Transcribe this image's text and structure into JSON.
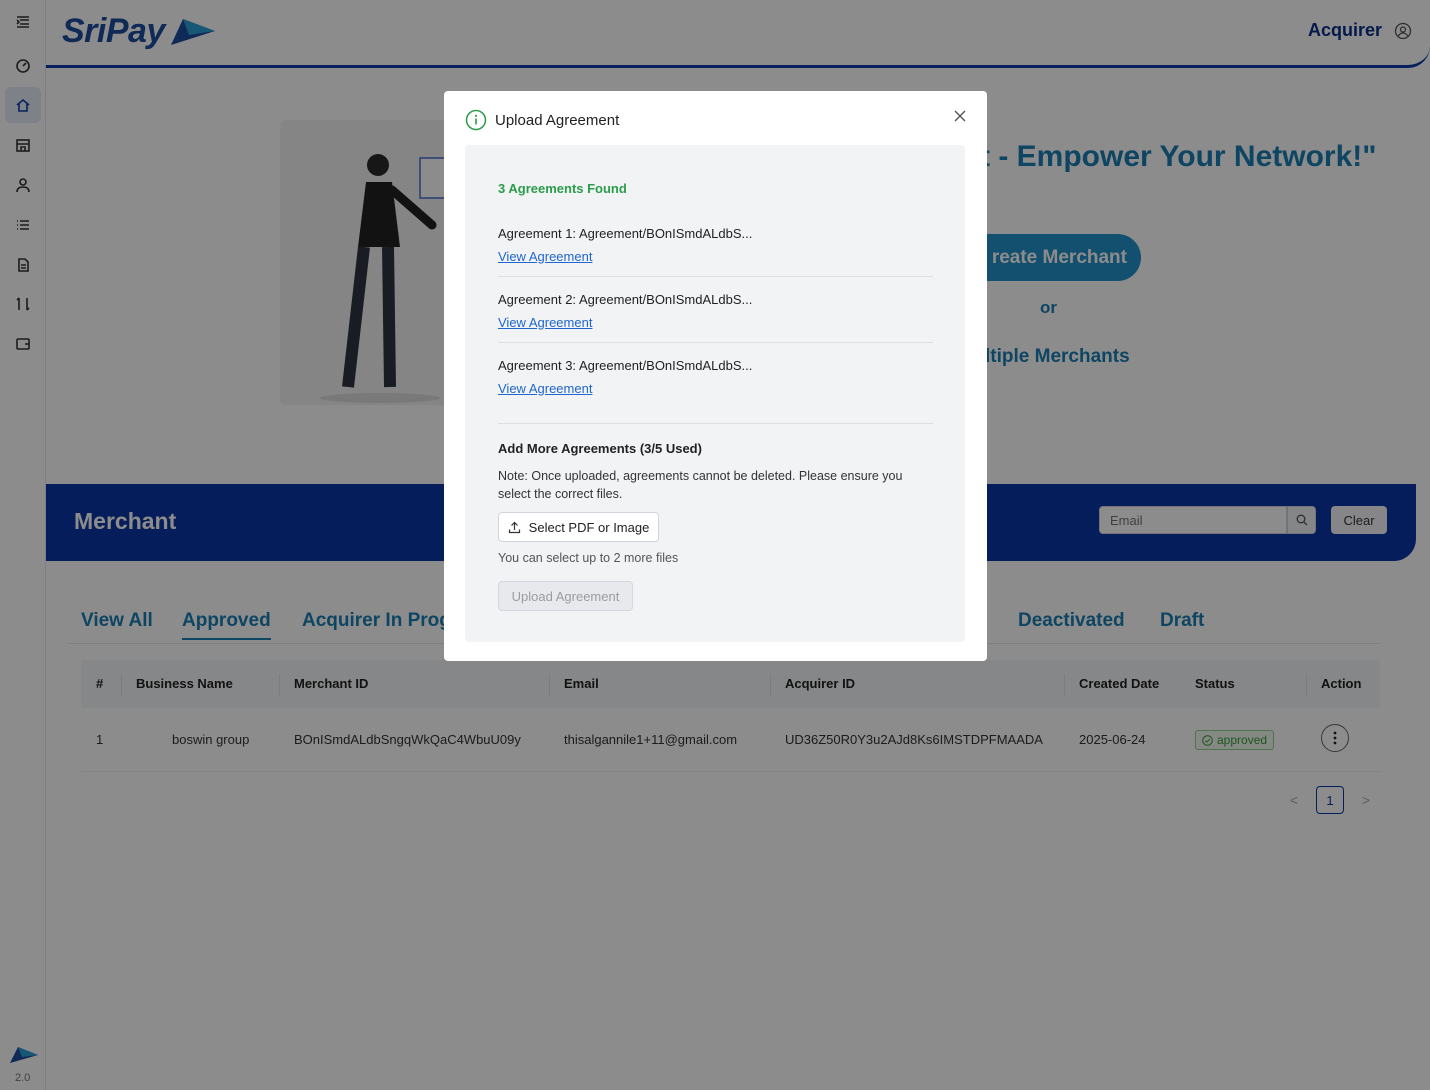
{
  "brand": {
    "logo_text": "SriPay",
    "version": "2.0"
  },
  "header": {
    "user_label": "Acquirer"
  },
  "sidebar": {
    "items": [
      {
        "icon": "menu-icon"
      },
      {
        "icon": "dashboard-icon"
      },
      {
        "icon": "home-icon",
        "active": true
      },
      {
        "icon": "store-icon"
      },
      {
        "icon": "user-icon"
      },
      {
        "icon": "list-icon"
      },
      {
        "icon": "document-icon"
      },
      {
        "icon": "transfer-icon"
      },
      {
        "icon": "wallet-icon"
      }
    ]
  },
  "hero": {
    "title": "t - Empower Your Network!\"",
    "create_button": "reate Merchant",
    "or_label": "or",
    "multi_label": "ltiple Merchants"
  },
  "merchant": {
    "title": "Merchant",
    "search_placeholder": "Email",
    "clear_label": "Clear",
    "tabs": [
      "View All",
      "Approved",
      "Acquirer In Prog",
      "l",
      "Deactivated",
      "Draft"
    ],
    "active_tab": "Approved",
    "table": {
      "headers": [
        "#",
        "Business Name",
        "Merchant ID",
        "Email",
        "Acquirer ID",
        "Created Date",
        "Status",
        "Action"
      ],
      "rows": [
        {
          "index": "1",
          "business_name": "boswin group",
          "merchant_id": "BOnISmdALdbSngqWkQaC4WbuU09y",
          "email": "thisalgannile1+11@gmail.com",
          "acquirer_id": "UD36Z50R0Y3u2AJd8Ks6IMSTDPFMAADA",
          "created_date": "2025-06-24",
          "status": "approved"
        }
      ]
    },
    "pagination": {
      "prev": "<",
      "current": "1",
      "next": ">"
    }
  },
  "modal": {
    "title": "Upload Agreement",
    "found_label": "3 Agreements Found",
    "agreements": [
      {
        "name": "Agreement 1: Agreement/BOnISmdALdbS...",
        "link": "View Agreement"
      },
      {
        "name": "Agreement 2: Agreement/BOnISmdALdbS...",
        "link": "View Agreement"
      },
      {
        "name": "Agreement 3: Agreement/BOnISmdALdbS...",
        "link": "View Agreement"
      }
    ],
    "add_title": "Add More Agreements (3/5 Used)",
    "note": "Note: Once uploaded, agreements cannot be deleted. Please ensure you select the correct files.",
    "select_button": "Select PDF or Image",
    "hint": "You can select up to 2 more files",
    "upload_button": "Upload Agreement"
  },
  "colors": {
    "primary": "#0a36a6",
    "accent": "#1a7fb2",
    "success": "#2a9c4a",
    "link": "#1e66d0"
  }
}
